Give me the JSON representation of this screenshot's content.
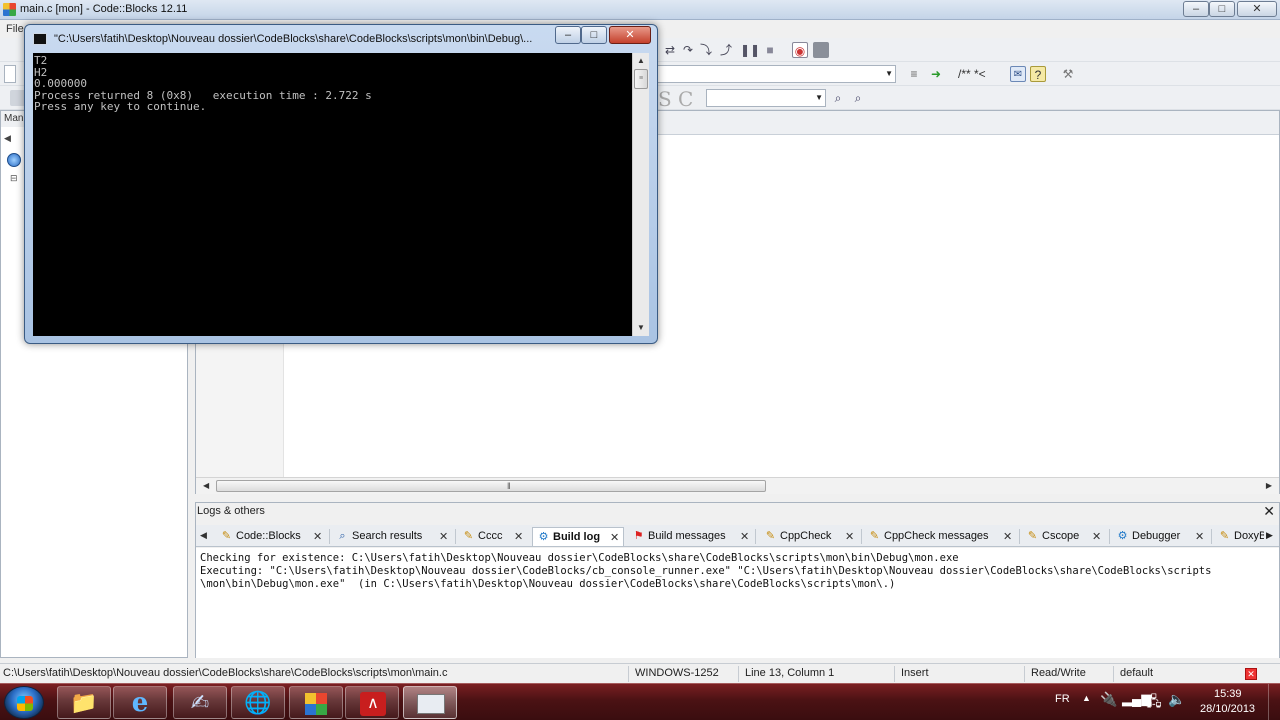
{
  "main_window": {
    "title": "main.c [mon] - Code::Blocks 12.11",
    "minimize": "–",
    "maximize": "□",
    "close": "✕"
  },
  "menu": {
    "first_item": "File"
  },
  "toolbar": {
    "comment_block": "/** *<",
    "letter_s": "S",
    "letter_c": "C"
  },
  "management": {
    "header": "Man"
  },
  "logs": {
    "title": "Logs & others",
    "close": "✕",
    "tabs": [
      {
        "label": "Code::Blocks",
        "icon": "document-icon"
      },
      {
        "label": "Search results",
        "icon": "magnifier-icon"
      },
      {
        "label": "Cccc",
        "icon": "document-icon"
      },
      {
        "label": "Build log",
        "icon": "gear-icon"
      },
      {
        "label": "Build messages",
        "icon": "pin-icon"
      },
      {
        "label": "CppCheck",
        "icon": "document-icon"
      },
      {
        "label": "CppCheck messages",
        "icon": "document-icon"
      },
      {
        "label": "Cscope",
        "icon": "document-icon"
      },
      {
        "label": "Debugger",
        "icon": "gear-icon"
      },
      {
        "label": "DoxyB",
        "icon": "document-icon"
      }
    ],
    "tab_close": "✕",
    "active_tab": "Build log",
    "lines": [
      "Checking for existence: C:\\Users\\fatih\\Desktop\\Nouveau dossier\\CodeBlocks\\share\\CodeBlocks\\scripts\\mon\\bin\\Debug\\mon.exe",
      "Executing: \"C:\\Users\\fatih\\Desktop\\Nouveau dossier\\CodeBlocks/cb_console_runner.exe\" \"C:\\Users\\fatih\\Desktop\\Nouveau dossier\\CodeBlocks\\share\\CodeBlocks\\scripts",
      "\\mon\\bin\\Debug\\mon.exe\"  (in C:\\Users\\fatih\\Desktop\\Nouveau dossier\\CodeBlocks\\share\\CodeBlocks\\scripts\\mon\\.)"
    ]
  },
  "status_bar": {
    "file_path": "C:\\Users\\fatih\\Desktop\\Nouveau dossier\\CodeBlocks\\share\\CodeBlocks\\scripts\\mon\\main.c",
    "encoding": "WINDOWS-1252",
    "position": "Line 13, Column 1",
    "mode": "Insert",
    "access": "Read/Write",
    "profile": "default"
  },
  "console": {
    "title": "\"C:\\Users\\fatih\\Desktop\\Nouveau dossier\\CodeBlocks\\share\\CodeBlocks\\scripts\\mon\\bin\\Debug\\...",
    "minimize": "–",
    "maximize": "□",
    "close": "✕",
    "lines": [
      "T2",
      "H2",
      "0.000000",
      "Process returned 8 (0x8)   execution time : 2.722 s",
      "Press any key to continue."
    ]
  },
  "taskbar": {
    "language": "FR",
    "time": "15:39",
    "date": "28/10/2013"
  },
  "colors": {
    "taskbar": "#4b1214",
    "console_bg": "#000000",
    "console_fg": "#c0c0c0",
    "title_glass": "#c9daf0"
  }
}
